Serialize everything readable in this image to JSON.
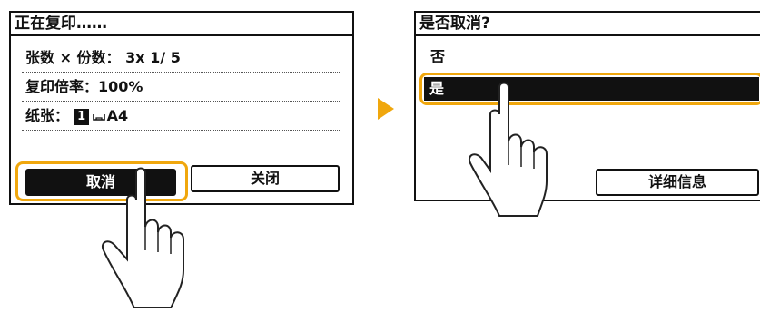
{
  "left_screen": {
    "title": "正在复印……",
    "copies": {
      "label": "张数 × 份数：",
      "value": "3x 1/ 5"
    },
    "ratio": {
      "label": "复印倍率：",
      "value": "100%"
    },
    "paper": {
      "label": "纸张：",
      "tray": "1",
      "size": "A4"
    },
    "cancel_button": "取消",
    "close_button": "关闭"
  },
  "right_screen": {
    "title": "是否取消?",
    "option_no": "否",
    "option_yes": "是",
    "details_button": "详细信息"
  },
  "colors": {
    "highlight": "#f0a70d",
    "selected_bg": "#111111"
  },
  "icons": [
    "tray-icon",
    "arrow-right-icon",
    "pointing-hand-icon"
  ]
}
